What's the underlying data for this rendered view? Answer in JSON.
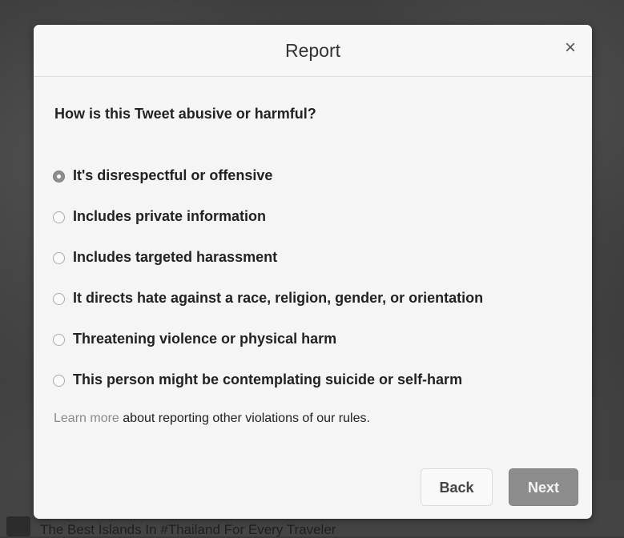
{
  "background": {
    "caption": "The Best Islands In #Thailand For Every Traveler"
  },
  "modal": {
    "title": "Report",
    "close_icon": "×",
    "question": "How is this Tweet abusive or harmful?",
    "options": [
      {
        "label": "It's disrespectful or offensive",
        "selected": true
      },
      {
        "label": "Includes private information",
        "selected": false
      },
      {
        "label": "Includes targeted harassment",
        "selected": false
      },
      {
        "label": "It directs hate against a race, religion, gender, or orientation",
        "selected": false
      },
      {
        "label": "Threatening violence or physical harm",
        "selected": false
      },
      {
        "label": "This person might be contemplating suicide or self-harm",
        "selected": false
      }
    ],
    "learn_more_link": "Learn more",
    "learn_more_text": "about reporting other violations of our rules.",
    "back_label": "Back",
    "next_label": "Next"
  },
  "colors": {
    "overlay": "#383838",
    "modal_background": "#f5f5f5",
    "next_button": "#8c8c8c",
    "link": "#8a8a8a"
  }
}
